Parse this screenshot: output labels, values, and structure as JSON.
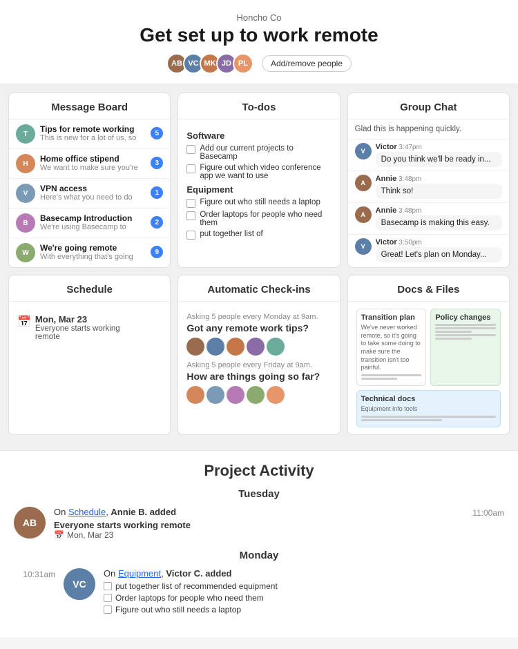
{
  "header": {
    "company": "Honcho Co",
    "title": "Get set up to work remote",
    "add_people_label": "Add/remove people",
    "avatars": [
      {
        "color": "#9b6b4e",
        "initials": "AB"
      },
      {
        "color": "#5b7fa6",
        "initials": "VC"
      },
      {
        "color": "#c4784a",
        "initials": "MK"
      },
      {
        "color": "#8b6ba6",
        "initials": "JD"
      },
      {
        "color": "#e8956a",
        "initials": "PL"
      }
    ]
  },
  "message_board": {
    "title": "Message Board",
    "items": [
      {
        "title": "Tips for remote working",
        "preview": "This is new for a lot of us, so",
        "badge": 5,
        "color": "#6aab9c"
      },
      {
        "title": "Home office stipend",
        "preview": "We want to make sure you're",
        "badge": 3,
        "color": "#d4875b"
      },
      {
        "title": "VPN access",
        "preview": "Here's what you need to do",
        "badge": 1,
        "color": "#7b9ab5"
      },
      {
        "title": "Basecamp Introduction",
        "preview": "We're using Basecamp to",
        "badge": 2,
        "color": "#b87ab5"
      },
      {
        "title": "We're going remote",
        "preview": "With everything that's going",
        "badge": 9,
        "color": "#8bab6e"
      }
    ]
  },
  "todos": {
    "title": "To-dos",
    "sections": [
      {
        "name": "Software",
        "items": [
          "Add our current projects to Basecamp",
          "Figure out which video conference app we want to use"
        ]
      },
      {
        "name": "Equipment",
        "items": [
          "Figure out who still needs a laptop",
          "Order laptops for people who need them",
          "put together list of"
        ]
      }
    ]
  },
  "group_chat": {
    "title": "Group Chat",
    "messages": [
      {
        "type": "right",
        "text": "Glad this is happening quickly.",
        "name": null,
        "time": null,
        "color": null
      },
      {
        "type": "left",
        "name": "Victor",
        "time": "3:47pm",
        "text": "Do you think we'll be ready in...",
        "color": "#5b7fa6"
      },
      {
        "type": "left",
        "name": "Annie",
        "time": "3:48pm",
        "text": "Think so!",
        "color": "#9b6b4e"
      },
      {
        "type": "left",
        "name": "Annie",
        "time": "3:48pm",
        "text": "Basecamp is making this easy.",
        "color": "#9b6b4e"
      },
      {
        "type": "left",
        "name": "Victor",
        "time": "3:50pm",
        "text": "Great! Let's plan on Monday...",
        "color": "#5b7fa6"
      }
    ]
  },
  "schedule": {
    "title": "Schedule",
    "event_date": "Mon, Mar 23",
    "event_desc1": "Everyone starts working",
    "event_desc2": "remote"
  },
  "auto_checkins": {
    "title": "Automatic Check-ins",
    "checkins": [
      {
        "ask": "Asking 5 people every Monday at 9am.",
        "question": "Got any remote work tips?",
        "avatars": [
          {
            "color": "#9b6b4e"
          },
          {
            "color": "#5b7fa6"
          },
          {
            "color": "#c4784a"
          },
          {
            "color": "#8b6ba6"
          },
          {
            "color": "#6aab9c"
          }
        ]
      },
      {
        "ask": "Asking 5 people every Friday at 9am.",
        "question": "How are things going so far?",
        "avatars": [
          {
            "color": "#d4875b"
          },
          {
            "color": "#7b9ab5"
          },
          {
            "color": "#b87ab5"
          },
          {
            "color": "#8bab6e"
          },
          {
            "color": "#e8956a"
          }
        ]
      }
    ]
  },
  "docs_files": {
    "title": "Docs & Files",
    "docs": [
      {
        "title": "Transition plan",
        "body": "We've never worked remote, so it's going to take some doing to make sure the transition isn't too painful.",
        "type": "white",
        "wide": false
      },
      {
        "title": "Policy changes",
        "body": "",
        "type": "green",
        "wide": false
      },
      {
        "title": "Technical docs",
        "body": "Equipment info tools",
        "type": "blue",
        "wide": true
      }
    ]
  },
  "activity": {
    "title": "Project Activity",
    "days": [
      {
        "name": "Tuesday",
        "items": [
          {
            "time": "11:00am",
            "avatar_color": "#9b6b4e",
            "left": true,
            "desc_pre": "On ",
            "link": "Schedule",
            "desc_post": ", Annie B. added",
            "event_name": "Everyone starts working remote",
            "event_date": "Mon, Mar 23"
          }
        ]
      },
      {
        "name": "Monday",
        "items": [
          {
            "time": "10:31am",
            "avatar_color": "#5b7fa6",
            "left": false,
            "desc_pre": "On ",
            "link": "Equipment",
            "desc_post": ", Victor C. added",
            "todos": [
              "put together list of recommended equipment",
              "Order laptops for people who need them",
              "Figure out who still needs a laptop"
            ]
          }
        ]
      }
    ]
  }
}
